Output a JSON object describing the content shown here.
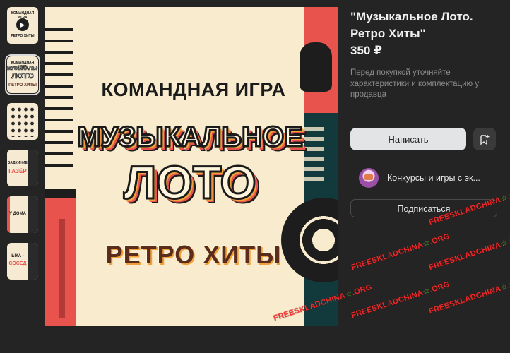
{
  "product": {
    "title": "\"Музыкальное Лото. Ретро Хиты\"",
    "price": "350 ₽",
    "note": "Перед покупкой уточняйте характеристики и комплектацию у продавца"
  },
  "actions": {
    "write_label": "Написать",
    "save_icon": "bookmark-add-icon",
    "subscribe_label": "Подписаться"
  },
  "seller": {
    "name": "Конкурсы и игры с эк..."
  },
  "hero": {
    "line1": "КОМАНДНАЯ ИГРА",
    "line2": "МУЗЫКАЛЬНОЕ",
    "line3": "ЛОТО",
    "line4": "РЕТРО ХИТЫ"
  },
  "thumbnails": {
    "t2_line1": "КОМАНДНАЯ ИГРА",
    "t2_line2": "МУЗЫКАЛЬНОЕ",
    "t2_line3": "ЛОТО",
    "t2_line4": "РЕТРО ХИТЫ",
    "t4_line1": "ЗАДКИНИЕ -",
    "t4_line2": "ГАЗЁР",
    "t5_line1": "Y ДОМА",
    "t6_line1": "ЫКА -",
    "t6_line2": "СОСЕД"
  },
  "watermark": {
    "prefix": "FREESKLADCHINA",
    "suffix": ".ORG",
    "star": "☆"
  },
  "colors": {
    "background": "#242424",
    "accent_red": "#e8534e",
    "cream": "#f9ecce",
    "dark_teal": "#123a3c",
    "button_light": "#e3e4e6"
  }
}
